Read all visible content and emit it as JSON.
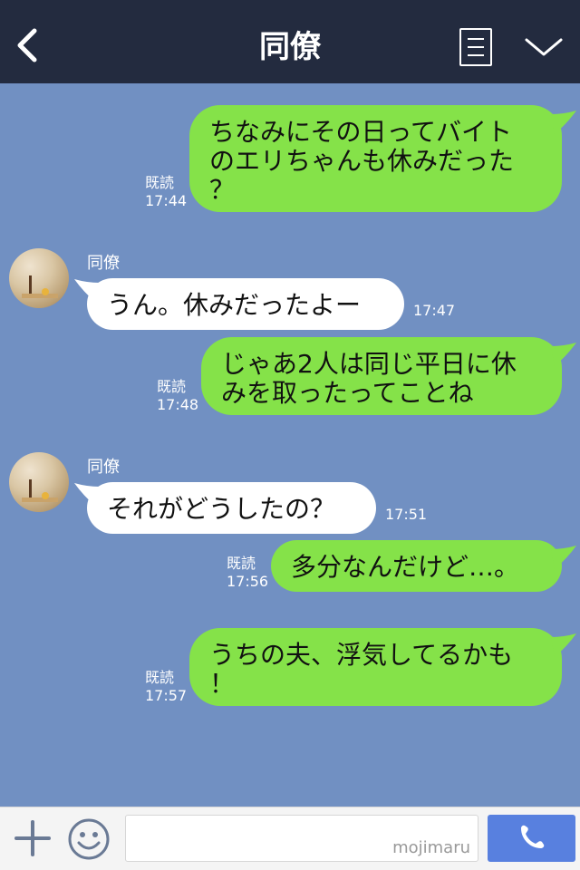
{
  "header": {
    "title": "同僚"
  },
  "messages": [
    {
      "side": "out",
      "text": "ちなみにその日ってバイト\nのエリちゃんも休みだった\n？",
      "read": "既読",
      "time": "17:44"
    },
    {
      "side": "in",
      "name": "同僚",
      "text": "うん。休みだったよー",
      "time": "17:47"
    },
    {
      "side": "out",
      "text": "じゃあ2人は同じ平日に休\nみを取ったってことね",
      "read": "既読",
      "time": "17:48"
    },
    {
      "side": "in",
      "name": "同僚",
      "text": "それがどうしたの？",
      "time": "17:51"
    },
    {
      "side": "out",
      "text": "多分なんだけど…。",
      "read": "既読",
      "time": "17:56"
    },
    {
      "side": "out",
      "text": "うちの夫、浮気してるかも\n！",
      "read": "既読",
      "time": "17:57"
    }
  ],
  "footer": {
    "watermark": "mojimaru",
    "input_value": ""
  },
  "icons": {
    "back": "chevron-left-icon",
    "memo": "notes-icon",
    "menu": "chevron-down-icon",
    "add": "plus-icon",
    "emoji": "smile-icon",
    "call": "phone-icon"
  },
  "colors": {
    "header": "#232b3f",
    "background": "#7190c2",
    "outgoing": "#85e249",
    "incoming": "#ffffff",
    "call_button": "#5880df"
  }
}
